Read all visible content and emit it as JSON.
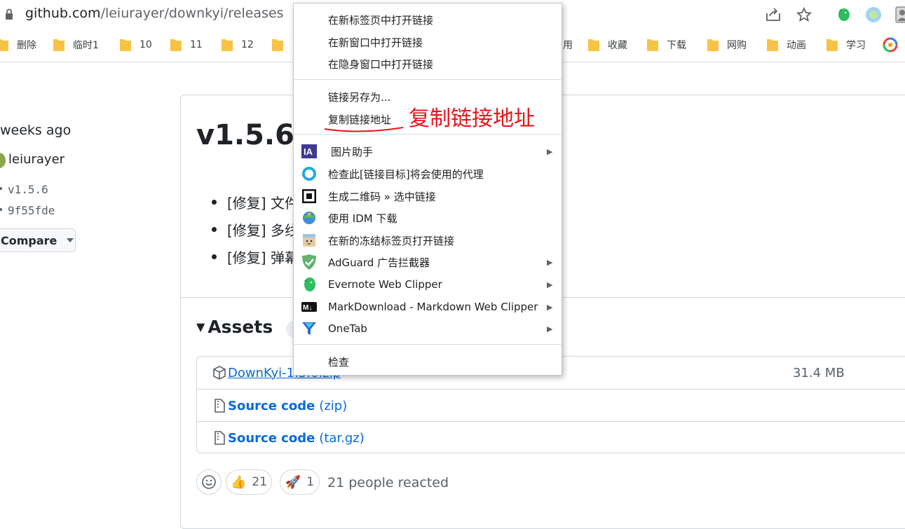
{
  "address_bar": {
    "url_host": "github.com",
    "url_path": "/leiurayer/downkyi/releases"
  },
  "bookmarks": [
    "删除",
    "临时1",
    "10",
    "11",
    "12",
    "用",
    "收藏",
    "下载",
    "网购",
    "动画",
    "学习"
  ],
  "sidebar": {
    "time_ago": "weeks ago",
    "author": "leiurayer",
    "tag": "v1.5.6",
    "commit": "9f55fde",
    "compare_label": "Compare"
  },
  "release": {
    "title": "v1.5.6",
    "notes": [
      "[修复] 文件",
      "[修复] 多线",
      "[修复] 弹幕"
    ],
    "assets_title": "Assets",
    "assets": [
      {
        "name": "DownKyi-1.5.6.zip",
        "ext": "",
        "size": "31.4 MB"
      },
      {
        "name": "Source code",
        "ext": "(zip)",
        "size": ""
      },
      {
        "name": "Source code",
        "ext": "(tar.gz)",
        "size": ""
      }
    ],
    "reactions": {
      "thumbs_up": "21",
      "rocket": "1",
      "summary": "21 people reacted"
    }
  },
  "context_menu": {
    "group1": [
      "在新标签页中打开链接",
      "在新窗口中打开链接",
      "在隐身窗口中打开链接"
    ],
    "group2": [
      "链接另存为...",
      "复制链接地址"
    ],
    "group3": [
      {
        "label": "图片助手",
        "icon": "ia-icon",
        "submenu": true
      },
      {
        "label": "检查此[链接目标]将会使用的代理",
        "icon": "proxy-ring-icon",
        "submenu": false
      },
      {
        "label": "生成二维码 » 选中链接",
        "icon": "qr-code-icon",
        "submenu": false
      },
      {
        "label": "使用 IDM 下载",
        "icon": "idm-globe-icon",
        "submenu": false
      },
      {
        "label": "在新的冻结标签页打开链接",
        "icon": "frozen-tab-icon",
        "submenu": false
      },
      {
        "label": "AdGuard 广告拦截器",
        "icon": "adguard-shield-icon",
        "submenu": true
      },
      {
        "label": "Evernote Web Clipper",
        "icon": "evernote-elephant-icon",
        "submenu": true
      },
      {
        "label": "MarkDownload - Markdown Web Clipper",
        "icon": "markdown-icon",
        "submenu": true
      },
      {
        "label": "OneTab",
        "icon": "onetab-funnel-icon",
        "submenu": true
      }
    ],
    "group4": [
      "检查"
    ]
  },
  "annotation": "复制链接地址",
  "colors": {
    "annotation": "#e8141a",
    "link": "#0969da",
    "folder": "#f6c344"
  }
}
